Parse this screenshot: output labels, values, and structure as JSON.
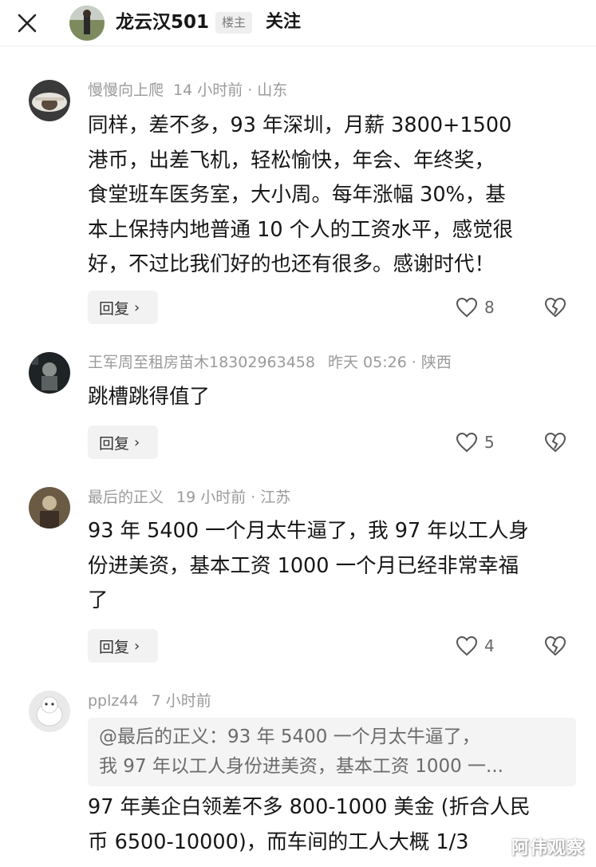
{
  "header": {
    "op_name": "龙云汉501",
    "op_badge": "楼主",
    "follow_label": "关注"
  },
  "icons": {
    "close": "close-icon",
    "like": "heart-icon",
    "dislike": "broken-heart-icon",
    "reply_chevron": "chevron-right-icon"
  },
  "comments": [
    {
      "user": "慢慢向上爬",
      "time": "14 小时前",
      "location": "山东",
      "text": "同样，差不多，93 年深圳，月薪 3800+1500\n港币，出差飞机，轻松愉快，年会、年终奖，\n食堂班车医务室，大小周。每年涨幅 30%，基\n本上保持内地普通 10 个人的工资水平，感觉很\n好，不过比我们好的也还有很多。感谢时代！",
      "reply_label": "回复",
      "likes": "8"
    },
    {
      "user": "王军周至租房苗木18302963458",
      "time": "昨天 05:26",
      "location": "陕西",
      "text": "跳槽跳得值了",
      "reply_label": "回复",
      "likes": "5"
    },
    {
      "user": "最后的正义",
      "time": "19 小时前",
      "location": "江苏",
      "text": "93 年 5400 一个月太牛逼了，我 97 年以工人身\n份进美资，基本工资 1000 一个月已经非常幸福\n了",
      "reply_label": "回复",
      "likes": "4"
    },
    {
      "user": "pplz44",
      "time": "7 小时前",
      "quote_line1": "@最后的正义：93 年 5400 一个月太牛逼了，",
      "quote_line2": "我 97 年以工人身份进美资，基本工资 1000 一...",
      "text": "97 年美企白领差不多 800-1000 美金 (折合人民\n币 6500-10000)，而车间的工人大概 1/3"
    }
  ],
  "watermark": "阿伟观察"
}
